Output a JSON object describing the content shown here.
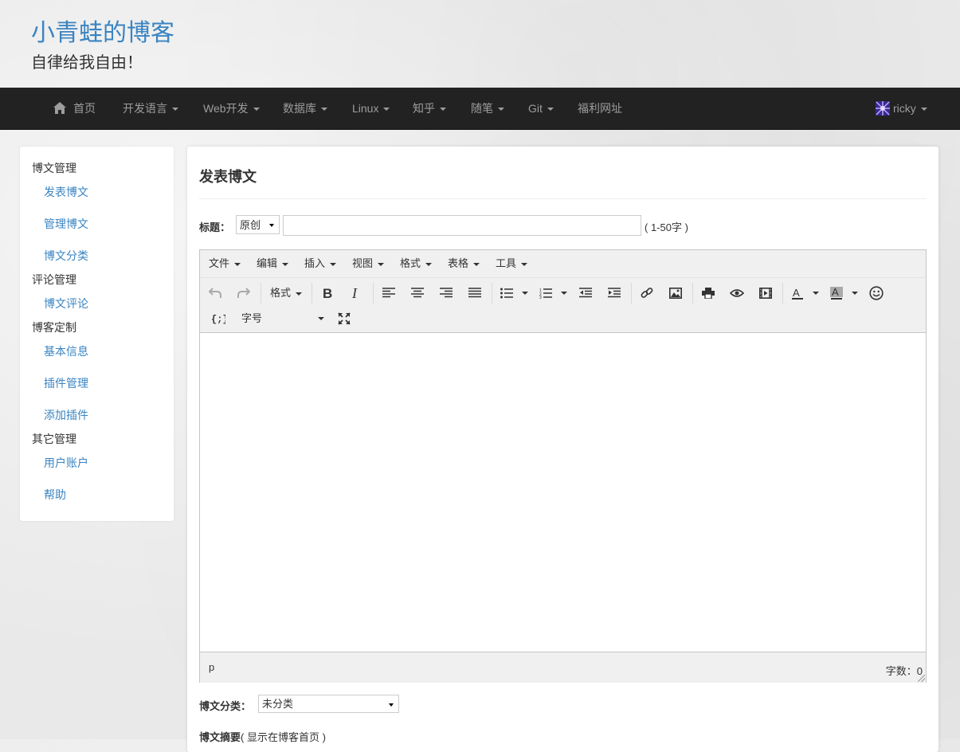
{
  "header": {
    "title": "小青蛙的博客",
    "subtitle": "自律给我自由！"
  },
  "nav": {
    "items": [
      {
        "label": "首页",
        "icon": "home-icon",
        "dropdown": false
      },
      {
        "label": "开发语言",
        "dropdown": true
      },
      {
        "label": "Web开发",
        "dropdown": true
      },
      {
        "label": "数据库",
        "dropdown": true
      },
      {
        "label": "Linux",
        "dropdown": true
      },
      {
        "label": "知乎",
        "dropdown": true
      },
      {
        "label": "随笔",
        "dropdown": true
      },
      {
        "label": "Git",
        "dropdown": true
      },
      {
        "label": "福利网址",
        "dropdown": false
      }
    ],
    "user": {
      "name": "ricky",
      "icon": "user-avatar-icon"
    }
  },
  "sidebar": {
    "groups": [
      {
        "title": "博文管理",
        "links": [
          "发表博文",
          "管理博文",
          "博文分类"
        ]
      },
      {
        "title": "评论管理",
        "links": [
          "博文评论"
        ]
      },
      {
        "title": "博客定制",
        "links": [
          "基本信息",
          "插件管理",
          "添加插件"
        ]
      },
      {
        "title": "其它管理",
        "links": [
          "用户账户",
          "帮助"
        ]
      }
    ]
  },
  "form": {
    "page_title": "发表博文",
    "title_label": "标题：",
    "type_select_value": "原创",
    "title_input_value": "",
    "title_hint": "( 1-50字 )",
    "category_label": "博文分类：",
    "category_value": "未分类",
    "summary_label": "博文摘要",
    "summary_hint": "( 显示在博客首页 )"
  },
  "editor": {
    "menus": [
      "文件",
      "编辑",
      "插入",
      "视图",
      "格式",
      "表格",
      "工具"
    ],
    "format_label": "格式",
    "font_size_label": "字号",
    "status_path": "p",
    "word_count_label": "字数：",
    "word_count": "0",
    "accent": "#3a84c2"
  }
}
